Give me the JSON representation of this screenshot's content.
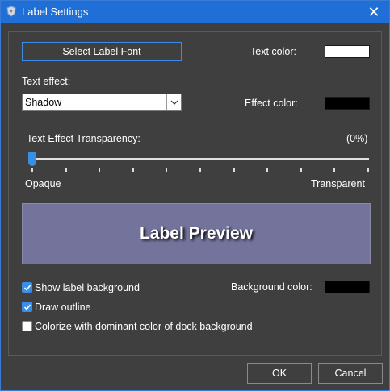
{
  "window": {
    "title": "Label Settings"
  },
  "font_button": {
    "label": "Select Label Font"
  },
  "text_color": {
    "label": "Text color:",
    "value": "#ffffff"
  },
  "text_effect": {
    "label": "Text effect:",
    "selected": "Shadow"
  },
  "effect_color": {
    "label": "Effect color:",
    "value": "#000000"
  },
  "transparency": {
    "label": "Text Effect Transparency:",
    "percent_text": "(0%)",
    "value": 0,
    "min_label": "Opaque",
    "max_label": "Transparent"
  },
  "preview": {
    "text": "Label Preview",
    "background": "#74739c"
  },
  "options": {
    "show_background": {
      "label": "Show label background",
      "checked": true
    },
    "draw_outline": {
      "label": "Draw outline",
      "checked": true
    },
    "colorize": {
      "label": "Colorize with dominant color of dock background",
      "checked": false
    }
  },
  "background_color": {
    "label": "Background color:",
    "value": "#000000"
  },
  "buttons": {
    "ok": "OK",
    "cancel": "Cancel"
  },
  "colors": {
    "titlebar": "#1f6fd6",
    "accent": "#3a8ee6"
  }
}
